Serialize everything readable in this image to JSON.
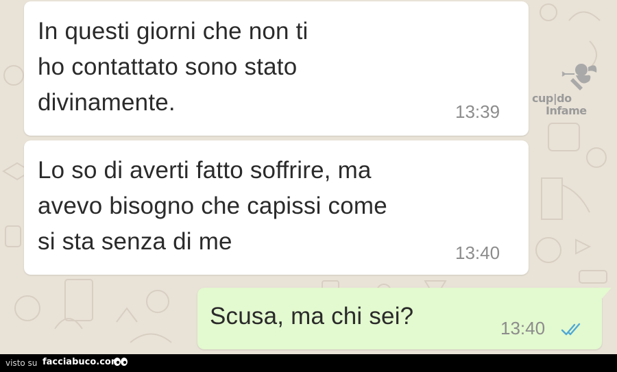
{
  "messages": [
    {
      "direction": "incoming",
      "text": "In questi giorni che non ti\nho contattato sono stato\ndivinamente.",
      "time": "13:39"
    },
    {
      "direction": "incoming",
      "text": "Lo so di averti fatto soffrire, ma\navevo bisogno che capissi come\nsi sta senza di me",
      "time": "13:40"
    },
    {
      "direction": "outgoing",
      "text": "Scusa, ma chi sei?",
      "time": "13:40",
      "status_icon": "double-check-read-icon"
    }
  ],
  "watermark": {
    "line1": "cup|do",
    "line2": "Infame",
    "icon": "cupid-icon"
  },
  "footer": {
    "prefix": "visto su",
    "brand": "facciabuco.com",
    "icon": "eyes-icon"
  },
  "colors": {
    "wallpaper": "#e9e2d7",
    "incoming_bubble": "#ffffff",
    "outgoing_bubble": "#e3f9cf",
    "read_ticks": "#4fa8d6",
    "footer_bar": "#000000"
  }
}
